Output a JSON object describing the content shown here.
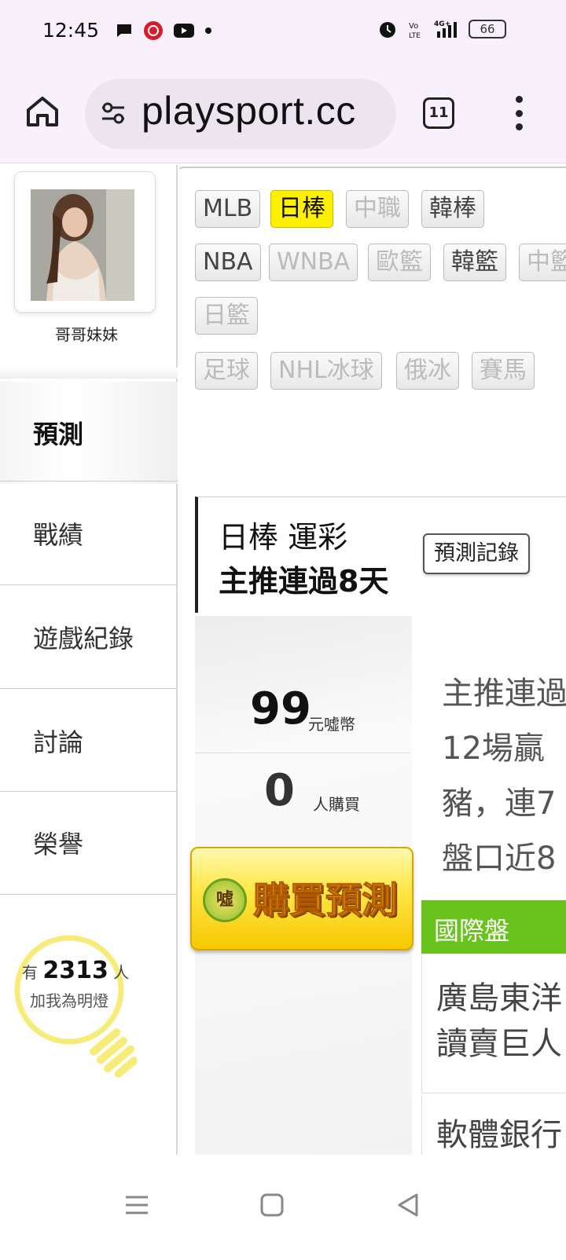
{
  "status_bar": {
    "time": "12:45",
    "battery": "66"
  },
  "browser": {
    "url": "playsport.cc",
    "tab_count": "11"
  },
  "sidebar": {
    "username": "哥哥妹妹",
    "active_item": "預測",
    "items": [
      "戰績",
      "遊戲紀錄",
      "討論",
      "榮譽"
    ],
    "fans_prefix": "有",
    "fans_count": "2313",
    "fans_suffix": "人",
    "fans_caption": "加我為明燈"
  },
  "leagues": [
    {
      "label": "MLB",
      "state": "normal"
    },
    {
      "label": "日棒",
      "state": "active"
    },
    {
      "label": "中職",
      "state": "dim"
    },
    {
      "label": "韓棒",
      "state": "normal"
    },
    {
      "label": "NBA",
      "state": "normal"
    },
    {
      "label": "WNBA",
      "state": "dim"
    },
    {
      "label": "歐籃",
      "state": "dim"
    },
    {
      "label": "韓籃",
      "state": "normal"
    },
    {
      "label": "中籃",
      "state": "dim"
    },
    {
      "label": "日籃",
      "state": "dim"
    },
    {
      "label": "足球",
      "state": "dim"
    },
    {
      "label": "NHL冰球",
      "state": "dim"
    },
    {
      "label": "俄冰",
      "state": "dim"
    },
    {
      "label": "賽馬",
      "state": "dim"
    }
  ],
  "prediction": {
    "title_line1": "日棒 運彩",
    "title_line2": "主推連過8天",
    "record_button": "預測記錄",
    "price": "99",
    "price_unit": "元噓幣",
    "buyers": "0",
    "buyers_unit": "人購買",
    "buy_button": "購買預測",
    "buy_icon_text": "噓",
    "description_lines": [
      "主推連過",
      "12場贏",
      "豬，連7",
      "盤口近8"
    ],
    "market_label": "國際盤",
    "matches": [
      {
        "lines": [
          "廣島東洋",
          "讀賣巨人"
        ]
      },
      {
        "lines": [
          "軟體銀行"
        ]
      }
    ]
  }
}
